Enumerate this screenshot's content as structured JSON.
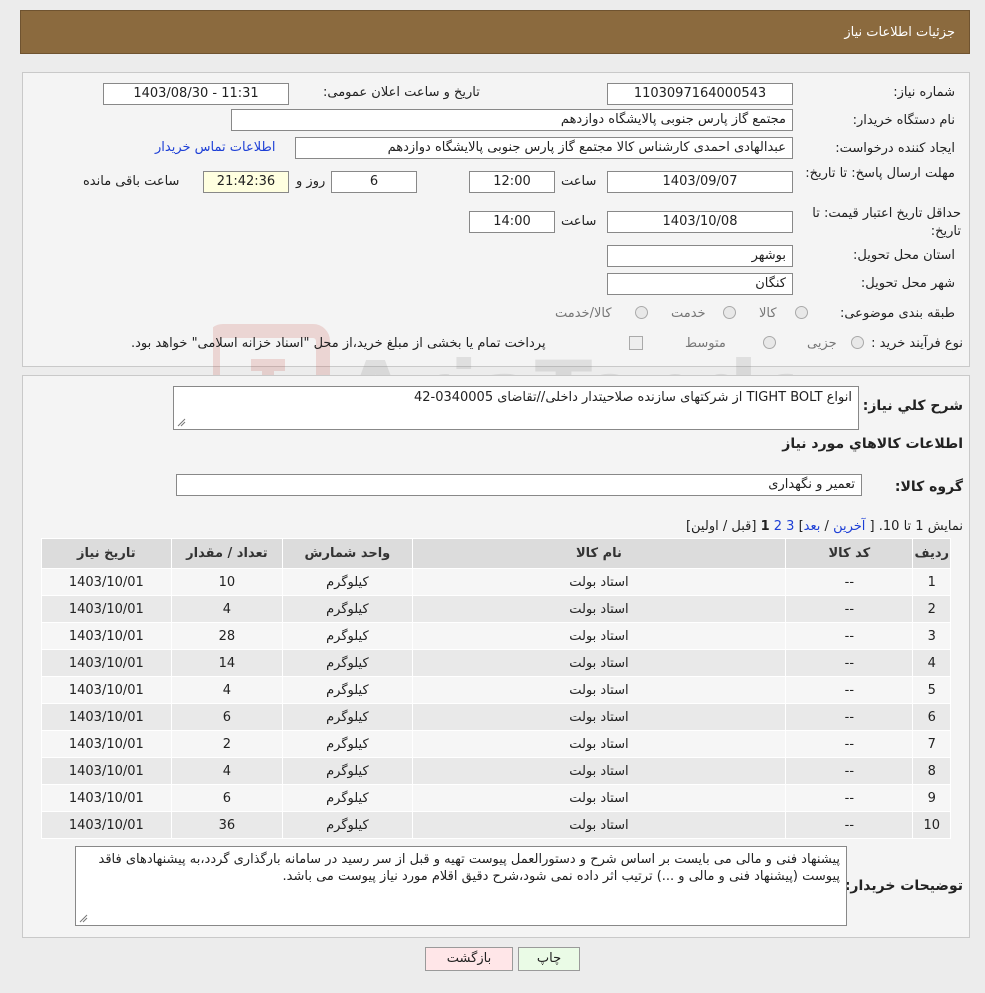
{
  "header": {
    "title": "جزئیات اطلاعات نیاز"
  },
  "info": {
    "need_number_label": "شماره نیاز:",
    "need_number": "1103097164000543",
    "announce_label": "تاریخ و ساعت اعلان عمومی:",
    "announce_value": "1403/08/30 - 11:31",
    "buyer_org_label": "نام دستگاه خریدار:",
    "buyer_org": "مجتمع گاز پارس جنوبی  پالایشگاه دوازدهم",
    "creator_label": "ایجاد کننده درخواست:",
    "creator": "عبدالهادی احمدی کارشناس کالا مجتمع گاز پارس جنوبی  پالایشگاه دوازدهم",
    "contact_link": "اطلاعات تماس خریدار",
    "deadline_label": "مهلت ارسال پاسخ: تا تاریخ:",
    "deadline_date": "1403/09/07",
    "time_label": "ساعت",
    "deadline_time": "12:00",
    "days_value": "6",
    "days_label": "روز و",
    "remaining_value": "21:42:36",
    "remaining_label": "ساعت باقی مانده",
    "validity_label": "حداقل تاریخ اعتبار قیمت: تا تاریخ:",
    "validity_date": "1403/10/08",
    "validity_time": "14:00",
    "province_label": "استان محل تحویل:",
    "province": "بوشهر",
    "city_label": "شهر محل تحویل:",
    "city": "کنگان",
    "category_label": "طبقه بندی موضوعی:",
    "category_options": [
      "کالا",
      "خدمت",
      "کالا/خدمت"
    ],
    "process_label": "نوع فرآیند خرید :",
    "process_options": [
      "جزیی",
      "متوسط"
    ],
    "process_note": "پرداخت تمام یا بخشی از مبلغ خرید،از محل \"اسناد خزانه اسلامی\" خواهد بود."
  },
  "details": {
    "summary_label": "شرح كلي نياز:",
    "summary": "انواع TIGHT BOLT از شرکتهای سازنده صلاحیتدار داخلی//تقاضای 0340005-42",
    "goods_info_title": "اطلاعات كالاهاي مورد نياز",
    "group_label": "گروه کالا:",
    "group_value": "تعمیر و نگهداری",
    "pagination": {
      "showing": "نمایش 1 تا 10.",
      "last": "آخرین",
      "next": "بعد",
      "p3": "3",
      "p2": "2",
      "p1": "1",
      "prev_first": "[قبل / اولین]"
    },
    "table": {
      "headers": [
        "ردیف",
        "کد کالا",
        "نام کالا",
        "واحد شمارش",
        "تعداد / مقدار",
        "تاریخ نیاز"
      ],
      "rows": [
        [
          "1",
          "--",
          "استاد بولت",
          "کیلوگرم",
          "10",
          "1403/10/01"
        ],
        [
          "2",
          "--",
          "استاد بولت",
          "کیلوگرم",
          "4",
          "1403/10/01"
        ],
        [
          "3",
          "--",
          "استاد بولت",
          "کیلوگرم",
          "28",
          "1403/10/01"
        ],
        [
          "4",
          "--",
          "استاد بولت",
          "کیلوگرم",
          "14",
          "1403/10/01"
        ],
        [
          "5",
          "--",
          "استاد بولت",
          "کیلوگرم",
          "4",
          "1403/10/01"
        ],
        [
          "6",
          "--",
          "استاد بولت",
          "کیلوگرم",
          "6",
          "1403/10/01"
        ],
        [
          "7",
          "--",
          "استاد بولت",
          "کیلوگرم",
          "2",
          "1403/10/01"
        ],
        [
          "8",
          "--",
          "استاد بولت",
          "کیلوگرم",
          "4",
          "1403/10/01"
        ],
        [
          "9",
          "--",
          "استاد بولت",
          "کیلوگرم",
          "6",
          "1403/10/01"
        ],
        [
          "10",
          "--",
          "استاد بولت",
          "کیلوگرم",
          "36",
          "1403/10/01"
        ]
      ]
    },
    "buyer_notes_label": "توضیحات خریدار:",
    "buyer_notes": "پیشنهاد فنی و مالی می بایست بر اساس شرح و دستورالعمل پیوست تهیه و قبل از سر رسید در سامانه بارگذاری گردد،به پیشنهادهای فاقد پیوست (پیشنهاد فنی و مالی و ...) ترتیب اثر داده نمی شود،شرح دقیق اقلام مورد نیاز پیوست می باشد."
  },
  "actions": {
    "print": "چاپ",
    "back": "بازگشت"
  },
  "watermark": {
    "text": "AriaTender.neT"
  }
}
